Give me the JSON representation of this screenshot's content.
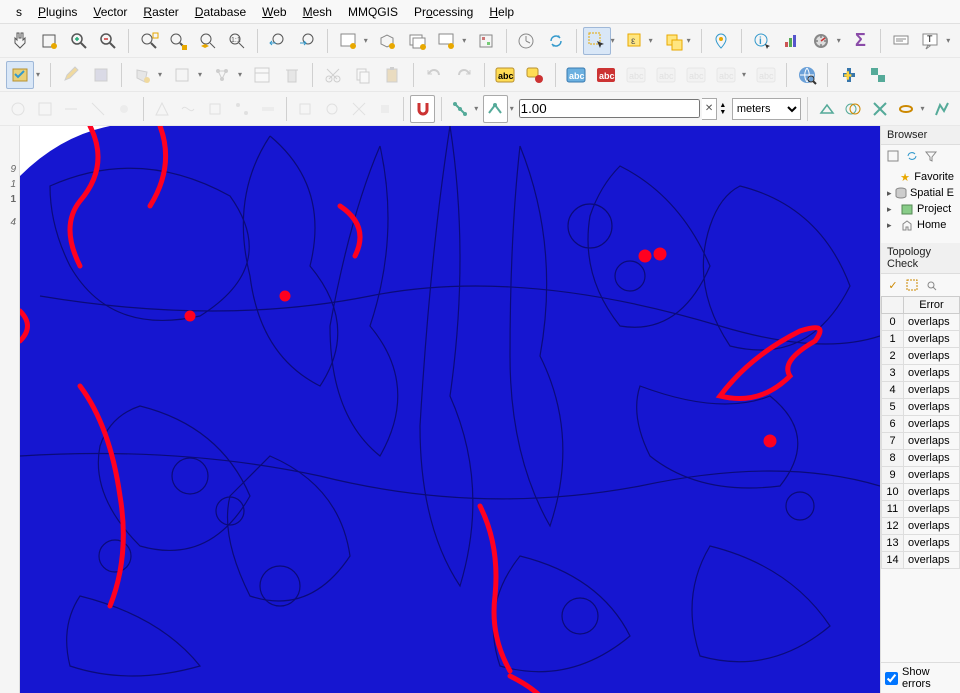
{
  "menus": [
    "s",
    "Plugins",
    "Vector",
    "Raster",
    "Database",
    "Web",
    "Mesh",
    "MMQGIS",
    "Processing",
    "Help"
  ],
  "menu_accel": [
    0,
    0,
    0,
    0,
    0,
    0,
    0,
    null,
    1,
    0
  ],
  "snap_value": "1.00",
  "snap_unit": "meters",
  "browser": {
    "title": "Browser",
    "items": [
      {
        "icon": "star",
        "label": "Favorite"
      },
      {
        "icon": "db",
        "label": "Spatial E",
        "toggle": "▸"
      },
      {
        "icon": "proj",
        "label": "Project",
        "toggle": "▸"
      },
      {
        "icon": "home",
        "label": "Home",
        "toggle": "▸"
      }
    ]
  },
  "topology": {
    "title": "Topology Check",
    "columns": [
      "",
      "Error"
    ],
    "rows": [
      {
        "i": 0,
        "err": "overlaps"
      },
      {
        "i": 1,
        "err": "overlaps"
      },
      {
        "i": 2,
        "err": "overlaps"
      },
      {
        "i": 3,
        "err": "overlaps"
      },
      {
        "i": 4,
        "err": "overlaps"
      },
      {
        "i": 5,
        "err": "overlaps"
      },
      {
        "i": 6,
        "err": "overlaps"
      },
      {
        "i": 7,
        "err": "overlaps"
      },
      {
        "i": 8,
        "err": "overlaps"
      },
      {
        "i": 9,
        "err": "overlaps"
      },
      {
        "i": 10,
        "err": "overlaps"
      },
      {
        "i": 11,
        "err": "overlaps"
      },
      {
        "i": 12,
        "err": "overlaps"
      },
      {
        "i": 13,
        "err": "overlaps"
      },
      {
        "i": 14,
        "err": "overlaps"
      }
    ],
    "show_errors_label": "Show errors",
    "show_errors_checked": true
  },
  "gutter_labels": [
    "9",
    "1",
    "1",
    "4"
  ]
}
